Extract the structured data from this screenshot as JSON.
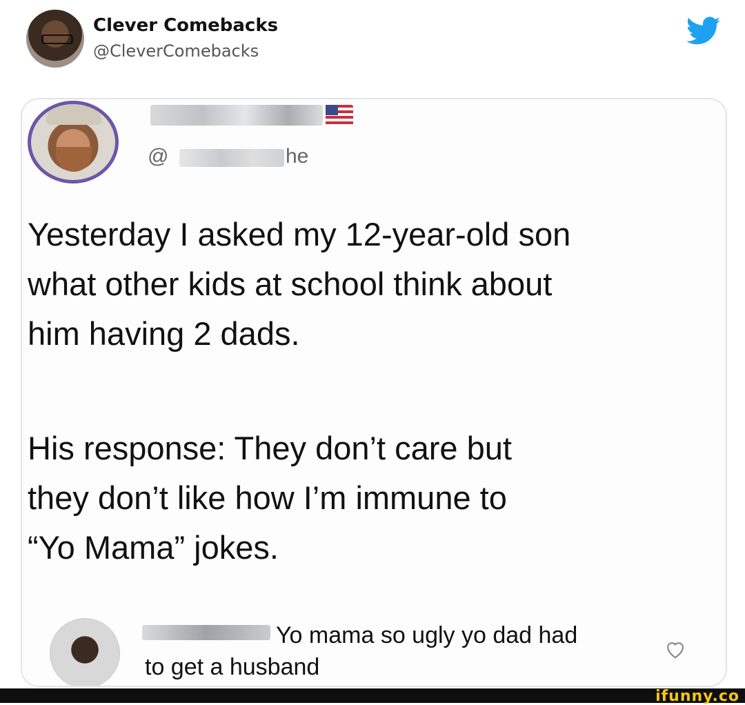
{
  "header": {
    "name": "Clever Comebacks",
    "handle": "@CleverComebacks",
    "icon": "twitter-bird-icon",
    "icon_color": "#1da1f2"
  },
  "embedded_tweet": {
    "handle_prefix": "@",
    "handle_suffix": "he",
    "paragraph_1": "Yesterday I asked my 12-year-old son\nwhat other kids at school think about\nhim having 2 dads.",
    "paragraph_2": "His response: They don’t care but\nthey don’t like how I’m immune to\n“Yo Mama” jokes."
  },
  "reply": {
    "text_line1": "Yo mama so ugly yo dad had",
    "text_line2": "to get a husband",
    "icon": "heart-icon"
  },
  "footer": {
    "watermark": "ifunny.co",
    "watermark_color": "#f5c518"
  }
}
